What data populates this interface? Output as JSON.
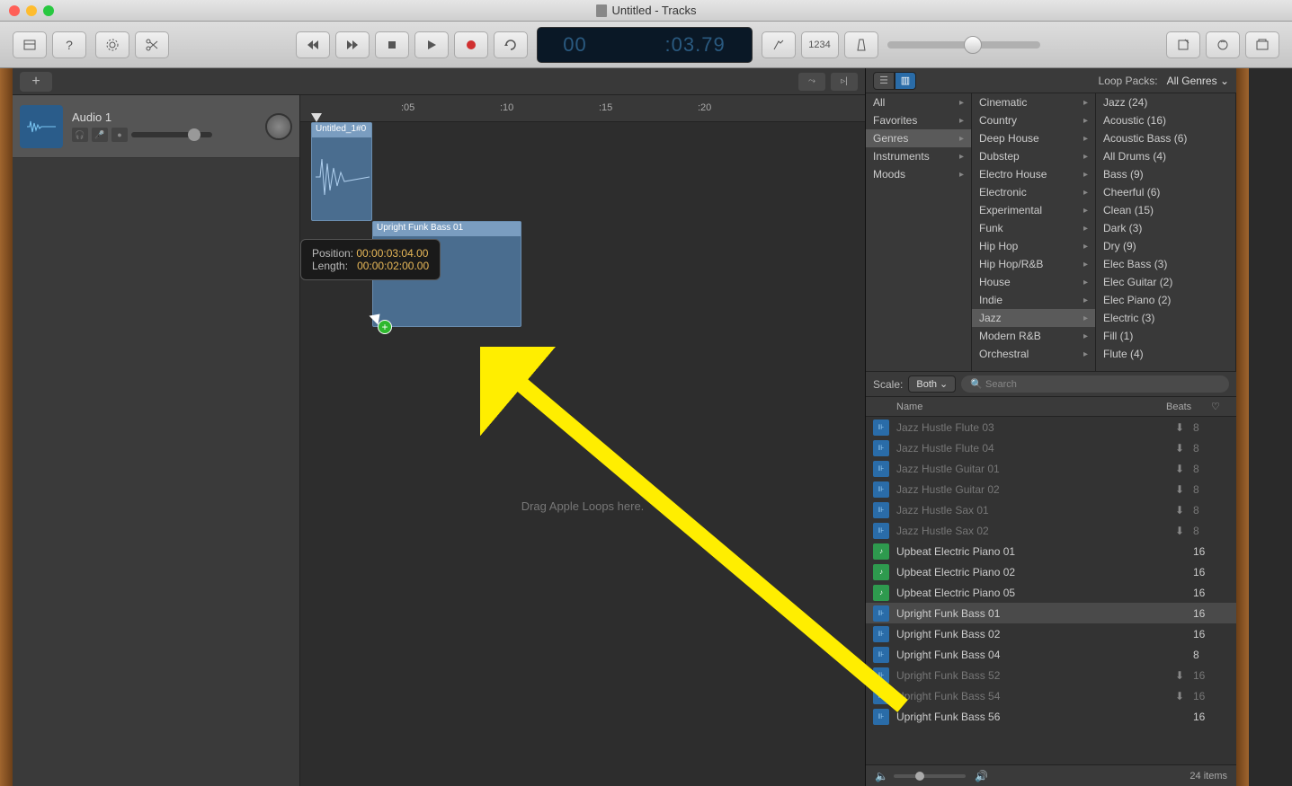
{
  "window": {
    "title": "Untitled - Tracks"
  },
  "lcd": {
    "dim1": "00",
    "main": "00:03",
    "dim2": ":03.79"
  },
  "toolbar": {
    "num_btn": "1234"
  },
  "ruler": {
    "t05": ":05",
    "t10": ":10",
    "t15": ":15",
    "t20": ":20"
  },
  "track": {
    "name": "Audio 1"
  },
  "regions": {
    "audio": {
      "name": "Untitled_1#0"
    },
    "loop": {
      "name": "Upright Funk Bass 01"
    }
  },
  "tooltip": {
    "pos_label": "Position:",
    "pos_value": "00:00:03:04.00",
    "len_label": "Length:",
    "len_value": "00:00:02:00.00"
  },
  "drag_hint": "Drag Apple Loops here.",
  "browser": {
    "loop_packs_label": "Loop Packs:",
    "loop_packs_value": "All Genres",
    "col1": [
      {
        "label": "All",
        "sel": false
      },
      {
        "label": "Favorites",
        "sel": false
      },
      {
        "label": "Genres",
        "sel": true
      },
      {
        "label": "Instruments",
        "sel": false
      },
      {
        "label": "Moods",
        "sel": false
      }
    ],
    "col2": [
      {
        "label": "Cinematic"
      },
      {
        "label": "Country"
      },
      {
        "label": "Deep House"
      },
      {
        "label": "Dubstep"
      },
      {
        "label": "Electro House"
      },
      {
        "label": "Electronic"
      },
      {
        "label": "Experimental"
      },
      {
        "label": "Funk"
      },
      {
        "label": "Hip Hop"
      },
      {
        "label": "Hip Hop/R&B"
      },
      {
        "label": "House"
      },
      {
        "label": "Indie"
      },
      {
        "label": "Jazz",
        "sel": true
      },
      {
        "label": "Modern R&B"
      },
      {
        "label": "Orchestral"
      }
    ],
    "col3": [
      {
        "label": "Jazz (24)"
      },
      {
        "label": "Acoustic (16)"
      },
      {
        "label": "Acoustic Bass (6)"
      },
      {
        "label": "All Drums (4)"
      },
      {
        "label": "Bass (9)"
      },
      {
        "label": "Cheerful (6)"
      },
      {
        "label": "Clean (15)"
      },
      {
        "label": "Dark (3)"
      },
      {
        "label": "Dry (9)"
      },
      {
        "label": "Elec Bass (3)"
      },
      {
        "label": "Elec Guitar (2)"
      },
      {
        "label": "Elec Piano (2)"
      },
      {
        "label": "Electric (3)"
      },
      {
        "label": "Fill (1)"
      },
      {
        "label": "Flute (4)"
      }
    ],
    "scale_label": "Scale:",
    "scale_value": "Both",
    "search_placeholder": "Search",
    "headers": {
      "name": "Name",
      "beats": "Beats"
    },
    "loops": [
      {
        "name": "Jazz Hustle Flute 03",
        "beats": "8",
        "dim": true,
        "dl": true,
        "icon": "blue"
      },
      {
        "name": "Jazz Hustle Flute 04",
        "beats": "8",
        "dim": true,
        "dl": true,
        "icon": "blue"
      },
      {
        "name": "Jazz Hustle Guitar 01",
        "beats": "8",
        "dim": true,
        "dl": true,
        "icon": "blue"
      },
      {
        "name": "Jazz Hustle Guitar 02",
        "beats": "8",
        "dim": true,
        "dl": true,
        "icon": "blue"
      },
      {
        "name": "Jazz Hustle Sax 01",
        "beats": "8",
        "dim": true,
        "dl": true,
        "icon": "blue"
      },
      {
        "name": "Jazz Hustle Sax 02",
        "beats": "8",
        "dim": true,
        "dl": true,
        "icon": "blue"
      },
      {
        "name": "Upbeat Electric Piano 01",
        "beats": "16",
        "icon": "green"
      },
      {
        "name": "Upbeat Electric Piano 02",
        "beats": "16",
        "icon": "green"
      },
      {
        "name": "Upbeat Electric Piano 05",
        "beats": "16",
        "icon": "green"
      },
      {
        "name": "Upright Funk Bass 01",
        "beats": "16",
        "icon": "blue",
        "sel": true
      },
      {
        "name": "Upright Funk Bass 02",
        "beats": "16",
        "icon": "blue"
      },
      {
        "name": "Upright Funk Bass 04",
        "beats": "8",
        "icon": "blue"
      },
      {
        "name": "Upright Funk Bass 52",
        "beats": "16",
        "dim": true,
        "dl": true,
        "icon": "blue"
      },
      {
        "name": "Upright Funk Bass 54",
        "beats": "16",
        "dim": true,
        "dl": true,
        "icon": "blue"
      },
      {
        "name": "Upright Funk Bass 56",
        "beats": "16",
        "icon": "blue"
      }
    ],
    "footer_count": "24 items"
  }
}
